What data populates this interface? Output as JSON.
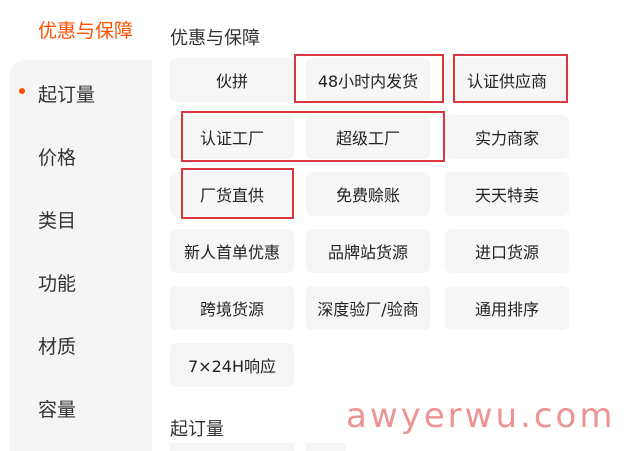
{
  "sidebar": {
    "header": "优惠与保障",
    "items": [
      {
        "label": "起订量",
        "active": true
      },
      {
        "label": "价格"
      },
      {
        "label": "类目"
      },
      {
        "label": "功能"
      },
      {
        "label": "材质"
      },
      {
        "label": "容量"
      }
    ]
  },
  "main": {
    "section_title": "优惠与保障",
    "chips": [
      "伙拼",
      "48小时内发货",
      "认证供应商",
      "认证工厂",
      "超级工厂",
      "实力商家",
      "厂货直供",
      "免费赊账",
      "天天特卖",
      "新人首单优惠",
      "品牌站货源",
      "进口货源",
      "跨境货源",
      "深度验厂/验商",
      "通用排序",
      "7×24H响应"
    ],
    "next_section_title": "起订量"
  },
  "watermark": "awyerwu.com",
  "colors": {
    "accent": "#ff5000",
    "highlight_box": "#d9363e",
    "chip_bg": "#f6f6f6",
    "sidebar_bg": "#f5f5f5"
  }
}
